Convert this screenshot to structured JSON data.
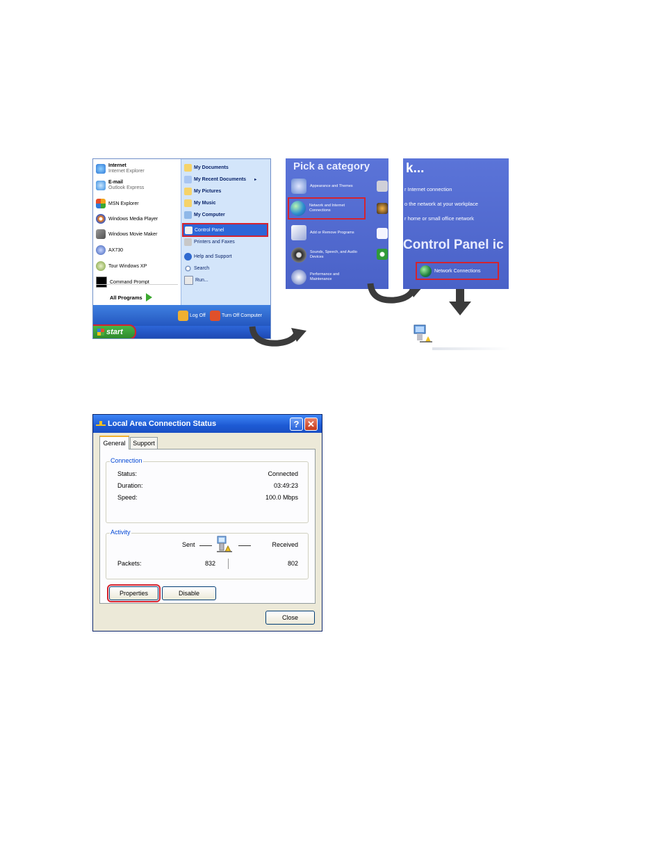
{
  "start_menu": {
    "left_items": [
      {
        "title": "Internet",
        "subtitle": "Internet Explorer",
        "icon": "internet-explorer-icon",
        "color": "#2f7ad8"
      },
      {
        "title": "E-mail",
        "subtitle": "Outlook Express",
        "icon": "outlook-express-icon",
        "color": "#3c8fe0"
      },
      {
        "title": "MSN Explorer",
        "icon": "msn-butterfly-icon",
        "color": "#f2a31c"
      },
      {
        "title": "Windows Media Player",
        "icon": "media-player-icon",
        "color": "#f07a18"
      },
      {
        "title": "Windows Movie Maker",
        "icon": "movie-maker-icon",
        "color": "#6f6f6f"
      },
      {
        "title": "AX730",
        "icon": "ax730-icon",
        "color": "#3c5fb8"
      },
      {
        "title": "Tour Windows XP",
        "icon": "tour-xp-icon",
        "color": "#7a9f3a"
      },
      {
        "title": "Command Prompt",
        "icon": "command-prompt-icon",
        "color": "#000000"
      }
    ],
    "all_programs": "All Programs",
    "right_items": [
      {
        "label": "My Documents",
        "icon": "folder-documents-icon",
        "bold": true
      },
      {
        "label": "My Recent Documents",
        "icon": "recent-documents-icon",
        "bold": true
      },
      {
        "label": "My Pictures",
        "icon": "folder-pictures-icon",
        "bold": true
      },
      {
        "label": "My Music",
        "icon": "folder-music-icon",
        "bold": true
      },
      {
        "label": "My Computer",
        "icon": "my-computer-icon",
        "bold": true
      },
      {
        "label": "Control Panel",
        "icon": "control-panel-icon",
        "bold": false
      },
      {
        "label": "Printers and Faxes",
        "icon": "printer-icon",
        "bold": false
      },
      {
        "label": "Help and Support",
        "icon": "help-icon",
        "bold": false
      },
      {
        "label": "Search",
        "icon": "search-icon",
        "bold": false
      },
      {
        "label": "Run...",
        "icon": "run-icon",
        "bold": false
      }
    ],
    "log_off": "Log Off",
    "turn_off": "Turn Off Computer",
    "start": "start"
  },
  "pick_category": {
    "title": "Pick a category",
    "items": [
      {
        "label": "Appearance and Themes",
        "icon": "appearance-icon",
        "color": "#6a8ad0"
      },
      {
        "label": "Network and Internet Connections",
        "icon": "network-globe-icon",
        "color": "#2f8fd0"
      },
      {
        "label": "Add or Remove Programs",
        "icon": "add-remove-icon",
        "color": "#d8d8e8"
      },
      {
        "label": "Sounds, Speech, and Audio Devices",
        "icon": "sound-icon",
        "color": "#2b2b2b"
      },
      {
        "label": "Performance and Maintenance",
        "icon": "performance-icon",
        "color": "#9aa8d8"
      }
    ]
  },
  "network_panel": {
    "heading": "k...",
    "lines": [
      "r Internet connection",
      "o the network at your workplace",
      "r home or small office network"
    ],
    "control_panel_icon": "Control Panel ic",
    "network_connections": "Network Connections"
  },
  "dialog": {
    "title": "Local Area Connection Status",
    "help": "?",
    "close_glyph": "✕",
    "tabs": [
      "General",
      "Support"
    ],
    "connection": {
      "label": "Connection",
      "rows": [
        {
          "name": "Status:",
          "value": "Connected"
        },
        {
          "name": "Duration:",
          "value": "03:49:23"
        },
        {
          "name": "Speed:",
          "value": "100.0 Mbps"
        }
      ]
    },
    "activity": {
      "label": "Activity",
      "sent": "Sent",
      "received": "Received",
      "packets_label": "Packets:",
      "packets_sent": "832",
      "packets_received": "802"
    },
    "buttons": {
      "properties": "Properties",
      "disable": "Disable",
      "close": "Close"
    }
  }
}
